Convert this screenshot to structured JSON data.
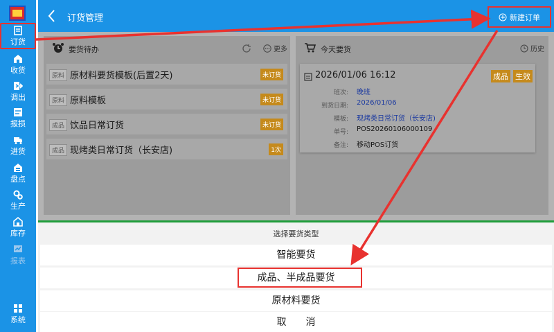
{
  "sidebar": {
    "items": [
      {
        "label": "订货",
        "icon": "order-icon"
      },
      {
        "label": "收货",
        "icon": "receive-icon"
      },
      {
        "label": "调出",
        "icon": "transfer-icon"
      },
      {
        "label": "报损",
        "icon": "loss-icon"
      },
      {
        "label": "进货",
        "icon": "purchase-icon"
      },
      {
        "label": "盘点",
        "icon": "inventory-icon"
      },
      {
        "label": "生产",
        "icon": "production-icon"
      },
      {
        "label": "库存",
        "icon": "stock-icon"
      },
      {
        "label": "报表",
        "icon": "report-icon"
      },
      {
        "label": "系统",
        "icon": "system-icon"
      }
    ]
  },
  "header": {
    "title": "订货管理",
    "new_order_label": "新建订单"
  },
  "pending": {
    "title": "要货待办",
    "more_label": "更多",
    "items": [
      {
        "tag": "原料",
        "name": "原材料要货模板(后置2天)",
        "badge": "未订货"
      },
      {
        "tag": "原料",
        "name": "原料模板",
        "badge": "未订货"
      },
      {
        "tag": "成品",
        "name": "饮品日常订货",
        "badge": "未订货"
      },
      {
        "tag": "成品",
        "name": "现烤类日常订货（长安店)",
        "badge": "1次"
      }
    ]
  },
  "today": {
    "title": "今天要货",
    "history_label": "历史",
    "card": {
      "datetime": "2026/01/06 16:12",
      "badge1": "成品",
      "badge2": "生效",
      "rows": [
        {
          "label": "班次:",
          "value": "晚班"
        },
        {
          "label": "到货日期:",
          "value": "2026/01/06"
        },
        {
          "label": "模板:",
          "value": "现烤类日常订货（长安店)"
        },
        {
          "label": "单号:",
          "value": "POS20260106000109"
        },
        {
          "label": "备注:",
          "value": "移动POS订货"
        }
      ]
    }
  },
  "sheet": {
    "title": "选择要货类型",
    "options": [
      "智能要货",
      "成品、半成品要货",
      "原材料要货",
      "取　　消"
    ]
  },
  "colors": {
    "primary": "#1b93e6",
    "highlight": "#e8322f",
    "badge": "#c58a1c",
    "sheet_border": "#1f9d3a"
  }
}
